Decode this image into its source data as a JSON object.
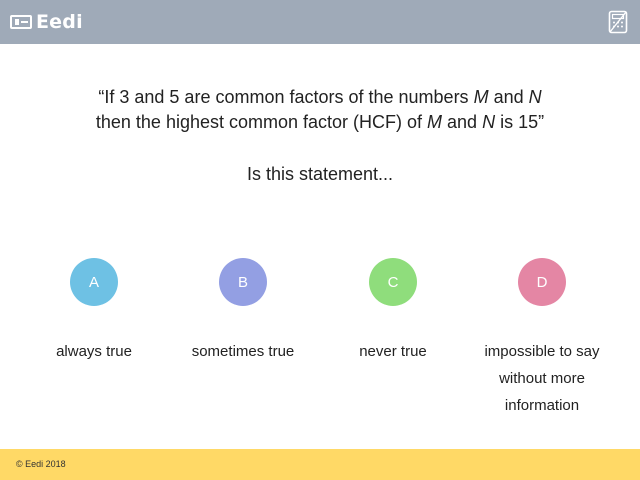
{
  "header": {
    "brand": "Eedi",
    "calculator_icon": "calculator-icon"
  },
  "question": {
    "line1": {
      "open_quote": "“",
      "w1": "If 3 and 5 are common factors of the numbers ",
      "var1": "M",
      "w2": " and ",
      "var2": "N"
    },
    "line2": {
      "w1": "then the highest common factor (HCF) of ",
      "var1": "M",
      "w2": " and ",
      "var2": "N",
      "w3": " is 15”"
    },
    "prompt": "Is this statement..."
  },
  "options": [
    {
      "letter": "A",
      "text": "always true",
      "color": "#6ec1e4"
    },
    {
      "letter": "B",
      "text": "sometimes true",
      "color": "#939fe3"
    },
    {
      "letter": "C",
      "text": "never true",
      "color": "#8fdd7c"
    },
    {
      "letter": "D",
      "text": "impossible to say without more information",
      "color": "#e486a4"
    }
  ],
  "colors": {
    "header_bg": "#9faab8",
    "footer_bg": "#ffd966"
  },
  "footer": {
    "copyright": "© Eedi 2018"
  }
}
